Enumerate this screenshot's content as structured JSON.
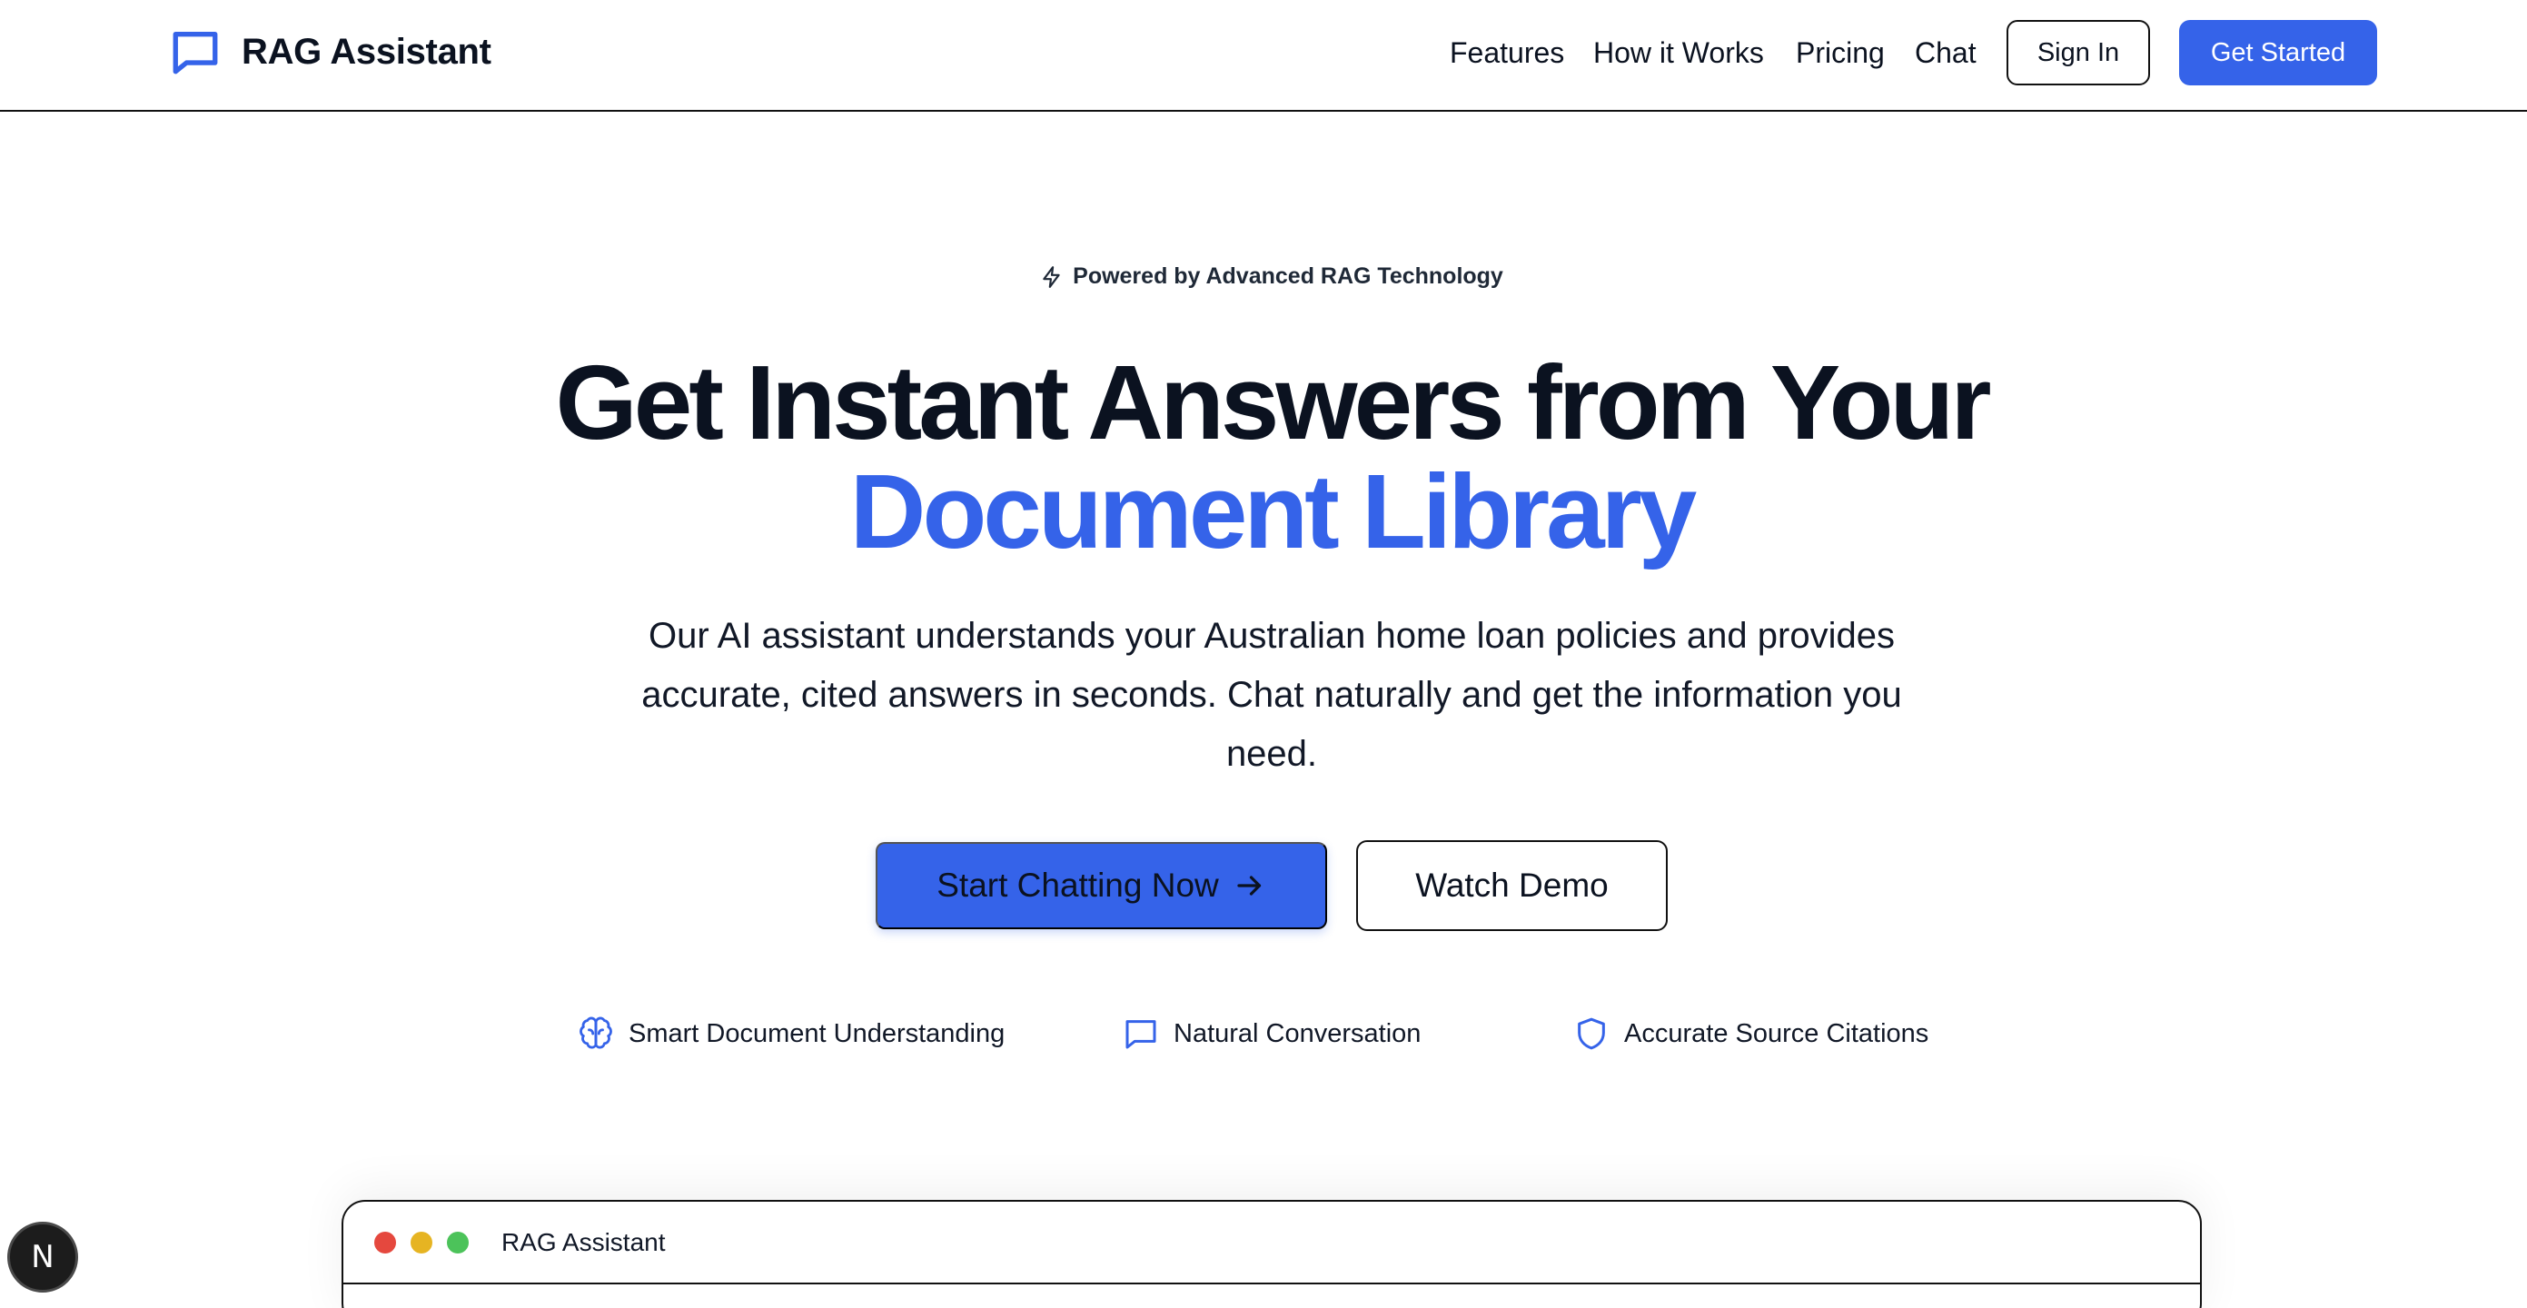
{
  "brand": {
    "name": "RAG Assistant",
    "icon": "chat-bubble-icon",
    "color": "#3563e9"
  },
  "nav": {
    "links": [
      "Features",
      "How it Works",
      "Pricing",
      "Chat"
    ],
    "sign_in": "Sign In",
    "get_started": "Get Started"
  },
  "hero": {
    "badge": "Powered by Advanced RAG Technology",
    "headline_line1": "Get Instant Answers from Your",
    "headline_line2": "Document Library",
    "subtext": "Our AI assistant understands your Australian home loan policies and provides accurate, cited answers in seconds. Chat naturally and get the information you need.",
    "primary_cta": "Start Chatting Now",
    "secondary_cta": "Watch Demo"
  },
  "features": [
    {
      "icon": "brain-icon",
      "label": "Smart Document Understanding"
    },
    {
      "icon": "chat-bubble-icon",
      "label": "Natural Conversation"
    },
    {
      "icon": "shield-icon",
      "label": "Accurate Source Citations"
    }
  ],
  "preview": {
    "title": "RAG Assistant",
    "dots": [
      "#e5483e",
      "#e6b422",
      "#4cc35a"
    ]
  },
  "dev_badge": {
    "label": "N"
  },
  "colors": {
    "accent": "#3563e9",
    "text": "#0b1220"
  }
}
